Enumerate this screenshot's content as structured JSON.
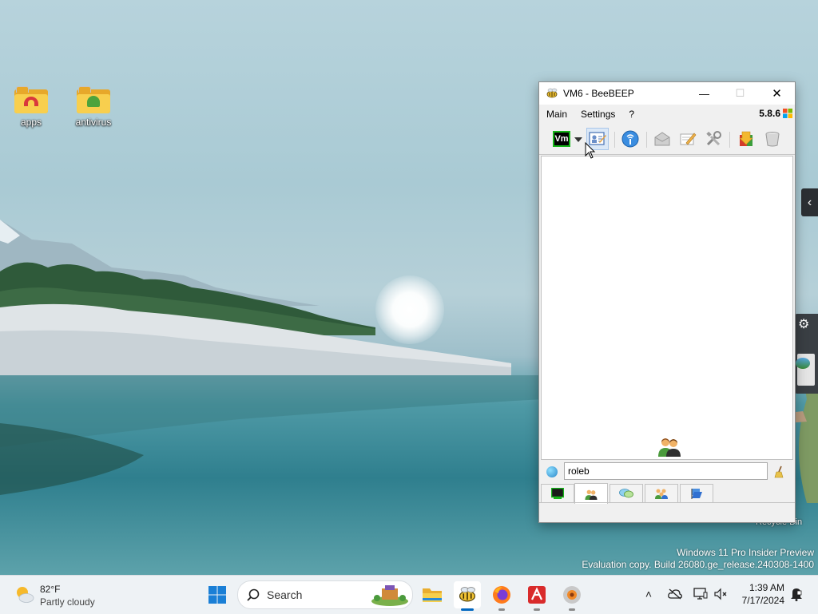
{
  "desktop": {
    "icons": [
      {
        "label": "apps"
      },
      {
        "label": "antivirus"
      }
    ],
    "recycle_bin_label": "Recycle Bin",
    "watermark": {
      "line1": "Windows 11 Pro Insider Preview",
      "line2": "Evaluation copy. Build 26080.ge_release.240308-1400"
    }
  },
  "window": {
    "title": "VM6 - BeeBEEP",
    "controls": {
      "minimize": "—",
      "maximize": "☐",
      "close": "✕"
    },
    "menu": [
      "Main",
      "Settings",
      "?"
    ],
    "version": "5.8.6",
    "toolbar": {
      "vm_badge": "Vm",
      "buttons": [
        "user-status-icon",
        "edit-profile-icon",
        "network-icon",
        "mail-icon",
        "write-note-icon",
        "tools-icon",
        "download-icon",
        "bucket-icon"
      ]
    },
    "input": {
      "value": "roleb"
    },
    "tabs": [
      "home-tab-icon",
      "users-tab-icon",
      "chats-tab-icon",
      "groups-tab-icon",
      "shares-tab-icon"
    ]
  },
  "taskbar": {
    "weather": {
      "temp": "82°F",
      "condition": "Partly cloudy"
    },
    "search": {
      "placeholder": "Search"
    },
    "apps": [
      "start-icon",
      "file-explorer-icon",
      "beebeep-icon",
      "firefox-icon",
      "acrobat-icon",
      "speaker-app-icon"
    ],
    "clock": {
      "time": "1:39 AM",
      "date": "7/17/2024"
    }
  }
}
